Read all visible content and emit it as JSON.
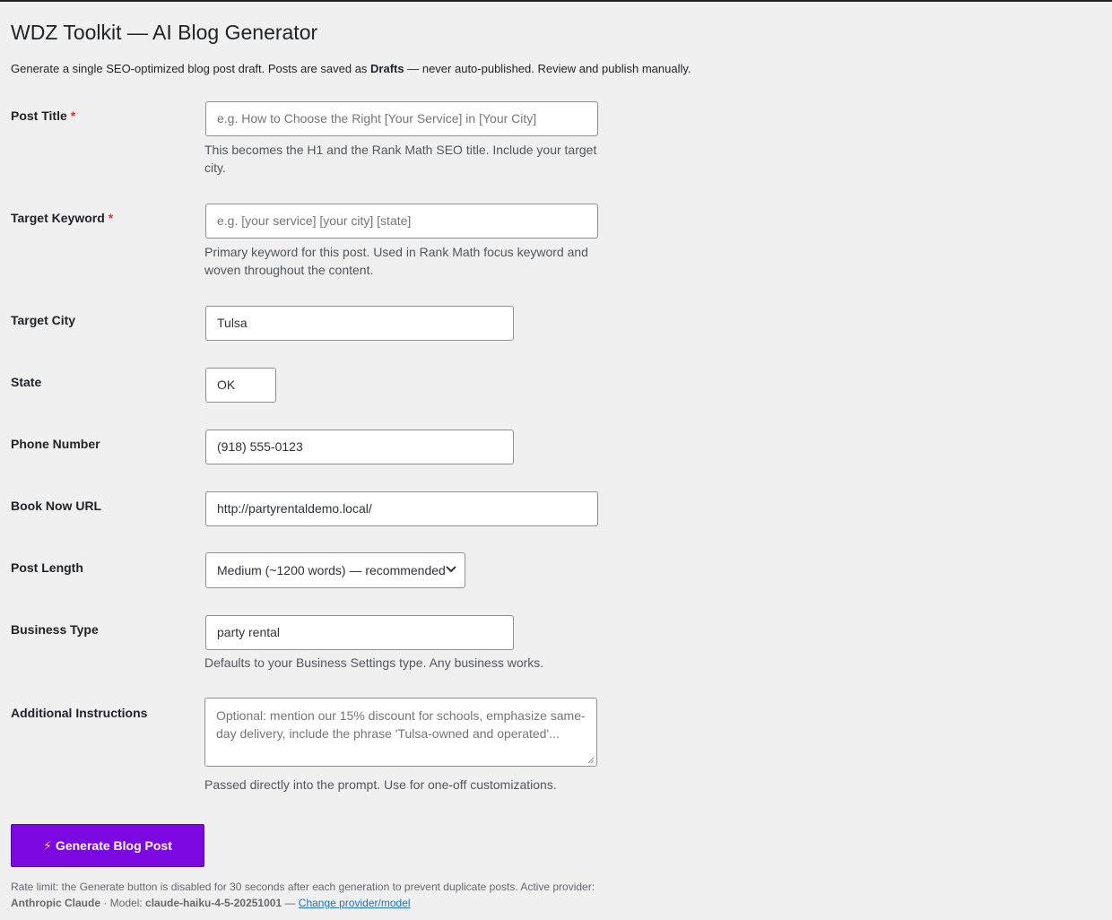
{
  "page": {
    "title": "WDZ Toolkit — AI Blog Generator",
    "intro_before": "Generate a single SEO-optimized blog post draft. Posts are saved as ",
    "intro_bold": "Drafts",
    "intro_after": " — never auto-published. Review and publish manually."
  },
  "fields": {
    "post_title": {
      "label": "Post Title",
      "required_mark": "*",
      "value": "",
      "placeholder": "e.g. How to Choose the Right [Your Service] in [Your City]",
      "description": "This becomes the H1 and the Rank Math SEO title. Include your target city."
    },
    "target_keyword": {
      "label": "Target Keyword",
      "required_mark": "*",
      "value": "",
      "placeholder": "e.g. [your service] [your city] [state]",
      "description": "Primary keyword for this post. Used in Rank Math focus keyword and woven throughout the content."
    },
    "target_city": {
      "label": "Target City",
      "value": "Tulsa"
    },
    "state": {
      "label": "State",
      "value": "OK"
    },
    "phone_number": {
      "label": "Phone Number",
      "value": "(918) 555-0123"
    },
    "book_now_url": {
      "label": "Book Now URL",
      "value": "http://partyrentaldemo.local/"
    },
    "post_length": {
      "label": "Post Length",
      "selected": "Medium (~1200 words) — recommended",
      "icon": "chevron-down-icon"
    },
    "business_type": {
      "label": "Business Type",
      "value": "party rental",
      "description": "Defaults to your Business Settings type. Any business works."
    },
    "additional_instructions": {
      "label": "Additional Instructions",
      "value": "",
      "placeholder": "Optional: mention our 15% discount for schools, emphasize same-day delivery, include the phrase 'Tulsa-owned and operated'...",
      "description": "Passed directly into the prompt. Use for one-off customizations."
    }
  },
  "generate_button": {
    "icon": "⚡",
    "label": "Generate Blog Post"
  },
  "footer": {
    "rate_limit_text": "Rate limit: the Generate button is disabled for 30 seconds after each generation to prevent duplicate posts. Active provider: ",
    "provider": "Anthropic Claude",
    "model_prefix": " · Model: ",
    "model": "claude-haiku-4-5-20251001",
    "separator": " — ",
    "change_link": "Change provider/model"
  },
  "colors": {
    "background": "#f0f0f1",
    "button_purple": "#7b08e0",
    "required_red": "#d63638",
    "link_blue": "#2271b1"
  }
}
